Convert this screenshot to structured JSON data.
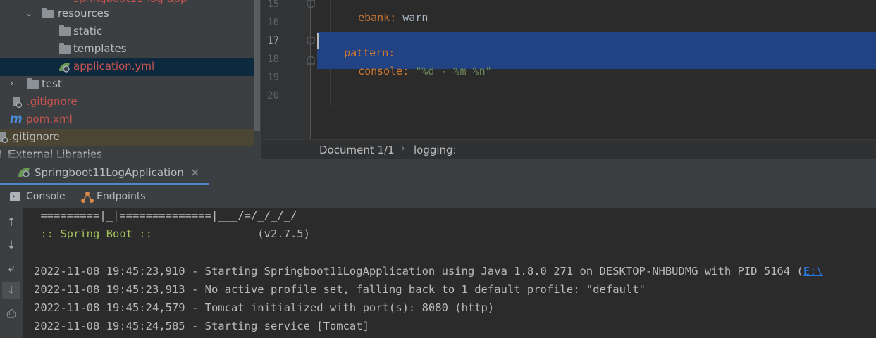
{
  "project_tree": {
    "items": [
      {
        "label": "resources",
        "kind": "folder"
      },
      {
        "label": "static",
        "kind": "folder"
      },
      {
        "label": "templates",
        "kind": "folder"
      },
      {
        "label": "application.yml",
        "kind": "yml",
        "selected": true
      },
      {
        "label": "test",
        "kind": "folder"
      },
      {
        "label": ".gitignore",
        "kind": "gitignore"
      },
      {
        "label": "pom.xml",
        "kind": "maven"
      },
      {
        "label": ".gitignore",
        "kind": "gitignore"
      },
      {
        "label": "External Libraries",
        "kind": "library"
      }
    ]
  },
  "editor": {
    "line_numbers": [
      "15",
      "16",
      "17",
      "18",
      "19",
      "20"
    ],
    "lines": [
      {
        "key": "ebank",
        "sep": ": ",
        "value": "warn"
      },
      {
        "key": "pattern",
        "sep": ":",
        "value": ""
      },
      {
        "key": "console",
        "sep": ": ",
        "value": "\"%d - %m %n\""
      }
    ],
    "breadcrumb": {
      "doc": "Document 1/1",
      "sep": "›",
      "path": "logging:"
    }
  },
  "run_window": {
    "tab_title": "Springboot11LogApplication",
    "close_glyph": "×",
    "tabs": [
      "Console",
      "Endpoints"
    ]
  },
  "console": {
    "banner_line": " =========|_|==============|___/=/_/_/_/",
    "spring_label": " :: Spring Boot :: ",
    "spring_version": "               (v2.7.5)",
    "log_lines": [
      "2022-11-08 19:45:23,910 - Starting Springboot11LogApplication using Java 1.8.0_271 on DESKTOP-NHBUDMG with PID 5164 (",
      "2022-11-08 19:45:23,913 - No active profile set, falling back to 1 default profile: \"default\"",
      "2022-11-08 19:45:24,579 - Tomcat initialized with port(s): 8080 (http)",
      "2022-11-08 19:45:24,585 - Starting service [Tomcat]"
    ],
    "log_link": "E:\\"
  },
  "colors": {
    "selection": "#214283",
    "yaml_key": "#cc7832",
    "yaml_string": "#6a8759",
    "spring_green": "#a5c25c",
    "link": "#287bde",
    "ignored_file": "#c75450"
  }
}
